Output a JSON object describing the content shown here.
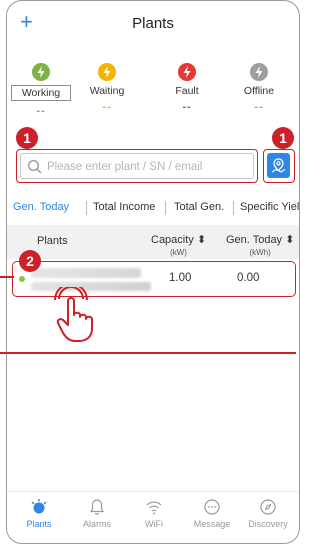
{
  "header": {
    "title": "Plants",
    "add_icon": "plus-icon"
  },
  "status": [
    {
      "label": "Working",
      "value": "--",
      "color": "#7cb342",
      "icon": "bolt-icon"
    },
    {
      "label": "Waiting",
      "value": "--",
      "color": "#f5b400",
      "icon": "bolt-icon"
    },
    {
      "label": "Fault",
      "value": "--",
      "color": "#e53935",
      "icon": "bolt-icon"
    },
    {
      "label": "Offline",
      "value": "--",
      "color": "#9e9e9e",
      "icon": "bolt-icon"
    }
  ],
  "search": {
    "placeholder": "Please enter plant / SN / email",
    "value": ""
  },
  "markers": [
    "1",
    "1",
    "2"
  ],
  "tabs": [
    {
      "label": "Gen. Today",
      "active": true
    },
    {
      "label": "Total Income"
    },
    {
      "label": "Total Gen."
    },
    {
      "label": "Specific Yield"
    }
  ],
  "table": {
    "col_plants": "Plants",
    "col_capacity": "Capacity ⬍",
    "col_capacity_unit": "(kW)",
    "col_gen": "Gen. Today ⬍",
    "col_gen_unit": "(kWh)"
  },
  "rows": [
    {
      "capacity": "1.00",
      "gen_today": "0.00",
      "status_color": "#8bc34a"
    }
  ],
  "nav": [
    {
      "label": "Plants",
      "icon": "plants-icon",
      "active": true
    },
    {
      "label": "Alarms",
      "icon": "bell-icon"
    },
    {
      "label": "WiFi",
      "icon": "wifi-icon"
    },
    {
      "label": "Message",
      "icon": "message-icon"
    },
    {
      "label": "Discovery",
      "icon": "compass-icon"
    }
  ],
  "colors": {
    "accent": "#2f86e6",
    "highlight": "#cc2129"
  }
}
